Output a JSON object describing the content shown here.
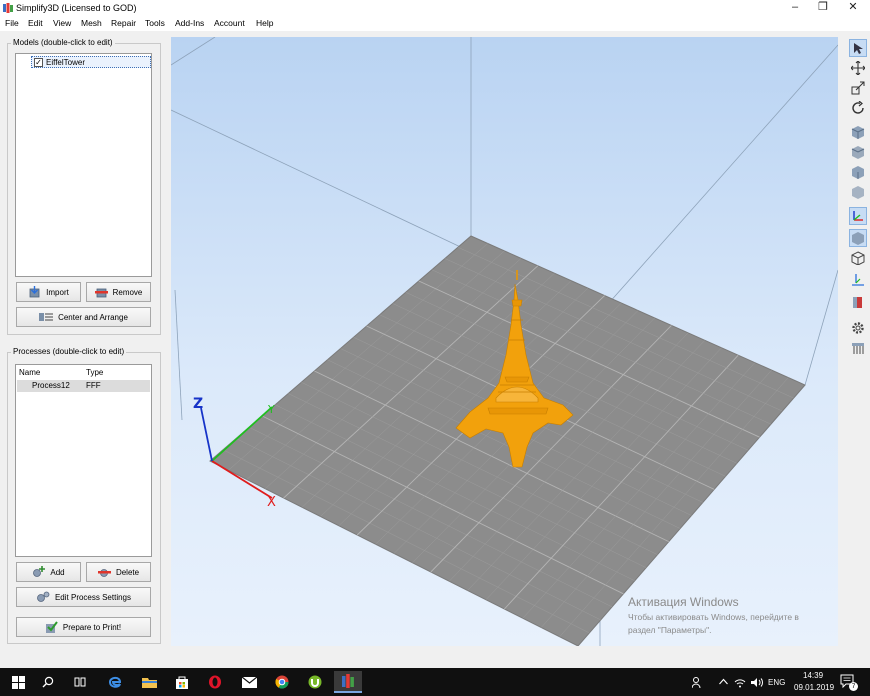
{
  "window": {
    "title": "Simplify3D (Licensed to GOD)",
    "minimize": "–",
    "restore": "❐",
    "close": "✕"
  },
  "menu": [
    "File",
    "Edit",
    "View",
    "Mesh",
    "Repair",
    "Tools",
    "Add-Ins",
    "Account",
    "Help"
  ],
  "models": {
    "title": "Models (double-click to edit)",
    "items": [
      {
        "name": "EiffelTower",
        "checked": true
      }
    ],
    "import_label": "Import",
    "remove_label": "Remove",
    "center_label": "Center and Arrange"
  },
  "processes": {
    "title": "Processes (double-click to edit)",
    "columns": [
      "Name",
      "Type"
    ],
    "rows": [
      {
        "name": "Process12",
        "type": "FFF"
      }
    ],
    "add_label": "Add",
    "delete_label": "Delete",
    "edit_label": "Edit Process Settings",
    "prepare_label": "Prepare to Print!"
  },
  "viewport": {
    "axis_labels": {
      "z": "Z",
      "x": "X",
      "y": "Y"
    },
    "model_color": "#f2a10c",
    "bed_color": "#8c8c8c"
  },
  "toolbar": {
    "tools": [
      "select-arrow-icon",
      "move-icon",
      "scale-icon",
      "rotate-icon",
      "view-iso-icon",
      "view-front-icon",
      "view-side-icon",
      "view-top-icon",
      "axes-icon",
      "solid-view-icon",
      "wireframe-view-icon",
      "coordinate-icon",
      "cross-section-icon",
      "settings-gear-icon",
      "supports-icon"
    ]
  },
  "watermark": {
    "line1": "Активация Windows",
    "line2": "Чтобы активировать Windows, перейдите в",
    "line3": "раздел \"Параметры\"."
  },
  "taskbar": {
    "lang": "ENG",
    "time": "14:39",
    "date": "09.01.2019",
    "notifications": "7"
  }
}
